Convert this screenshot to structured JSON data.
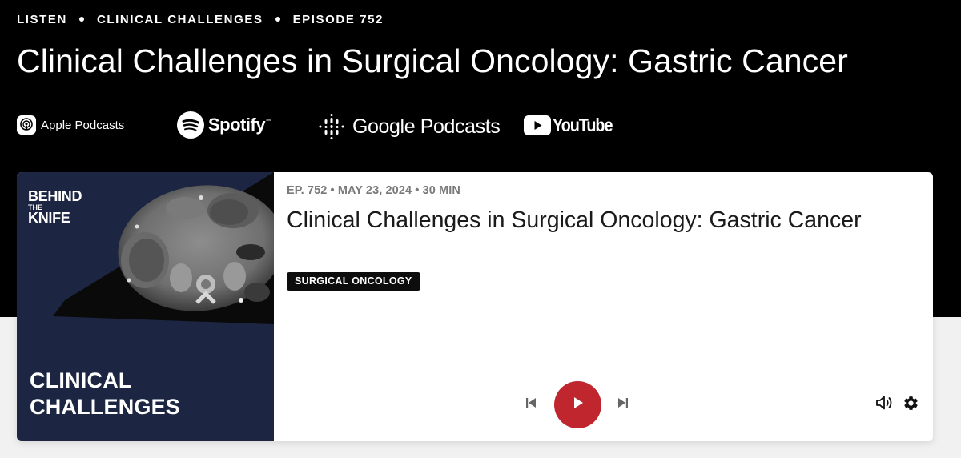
{
  "breadcrumbs": [
    "LISTEN",
    "CLINICAL CHALLENGES",
    "EPISODE 752"
  ],
  "page_title": "Clinical Challenges in Surgical Oncology: Gastric Cancer",
  "platforms": {
    "apple": "Apple Podcasts",
    "spotify": "Spotify",
    "google": "Google Podcasts",
    "youtube": "YouTube"
  },
  "artwork": {
    "brand_line1": "BEHIND",
    "brand_line2": "THE",
    "brand_line3": "KNIFE",
    "series_line1": "CLINICAL",
    "series_line2": "CHALLENGES"
  },
  "episode": {
    "meta": "EP. 752 • MAY 23, 2024 • 30 MIN",
    "title": "Clinical Challenges in Surgical Oncology: Gastric Cancer",
    "tag": "SURGICAL ONCOLOGY"
  },
  "player": {
    "controls": [
      "skip-previous-icon",
      "play-icon",
      "skip-next-icon",
      "volume-icon",
      "settings-gear-icon"
    ]
  },
  "colors": {
    "hero_bg": "#000000",
    "artwork_bg": "#1c2541",
    "play_button": "#c0262d",
    "tag_bg": "#0d0d0d",
    "meta_text": "#7a7a7a"
  }
}
